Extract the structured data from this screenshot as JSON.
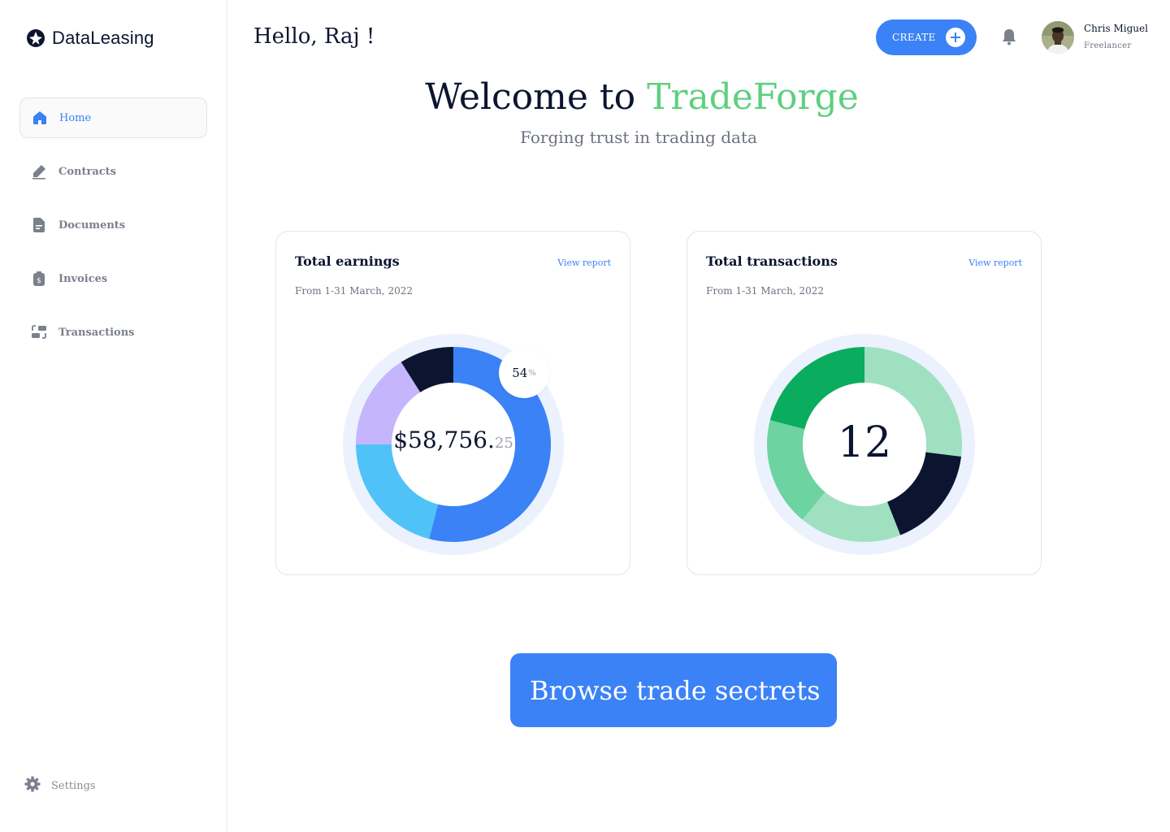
{
  "app": {
    "name": "DataLeasing"
  },
  "sidebar": {
    "items": [
      {
        "label": "Home",
        "icon": "home-icon",
        "active": true
      },
      {
        "label": "Contracts",
        "icon": "pen-icon",
        "active": false
      },
      {
        "label": "Documents",
        "icon": "document-icon",
        "active": false
      },
      {
        "label": "Invoices",
        "icon": "invoice-icon",
        "active": false
      },
      {
        "label": "Transactions",
        "icon": "transactions-icon",
        "active": false
      }
    ],
    "settings_label": "Settings"
  },
  "header": {
    "greeting": "Hello, Raj !",
    "create_label": "CREATE",
    "user": {
      "name": "Chris Miguel",
      "role": "Freelancer"
    }
  },
  "hero": {
    "title_prefix": "Welcome to ",
    "title_brand": "TradeForge",
    "subtitle": "Forging trust in trading data"
  },
  "colors": {
    "accent": "#3b82f6",
    "brand_green": "#5fcf80",
    "navy": "#0b1530"
  },
  "cards": {
    "earnings": {
      "title": "Total earnings",
      "link": "View report",
      "period": "From 1-31 March, 2022",
      "amount_main": "$58,756.",
      "amount_cents": "25",
      "percent_value": "54",
      "percent_sign": "%"
    },
    "transactions": {
      "title": "Total transactions",
      "link": "View report",
      "period": "From 1-31 March, 2022",
      "count": "12"
    }
  },
  "cta": {
    "label": "Browse trade sectrets"
  },
  "chart_data": [
    {
      "type": "pie",
      "variant": "donut",
      "labels": [
        "",
        "",
        "",
        ""
      ],
      "values": [
        54,
        21,
        16,
        9
      ],
      "colors": [
        "#3b82f6",
        "#4fc3f7",
        "#c4b5fd",
        "#0b1530"
      ],
      "center_label": "$58,756.25",
      "callout": "54%"
    },
    {
      "type": "pie",
      "variant": "donut",
      "labels": [
        "",
        "",
        "",
        "",
        ""
      ],
      "values": [
        27,
        17,
        17,
        18,
        21
      ],
      "colors": [
        "#9fe0c0",
        "#0b1530",
        "#9fe0c0",
        "#6dd3a0",
        "#09ad5d"
      ],
      "center_label": "12"
    }
  ]
}
